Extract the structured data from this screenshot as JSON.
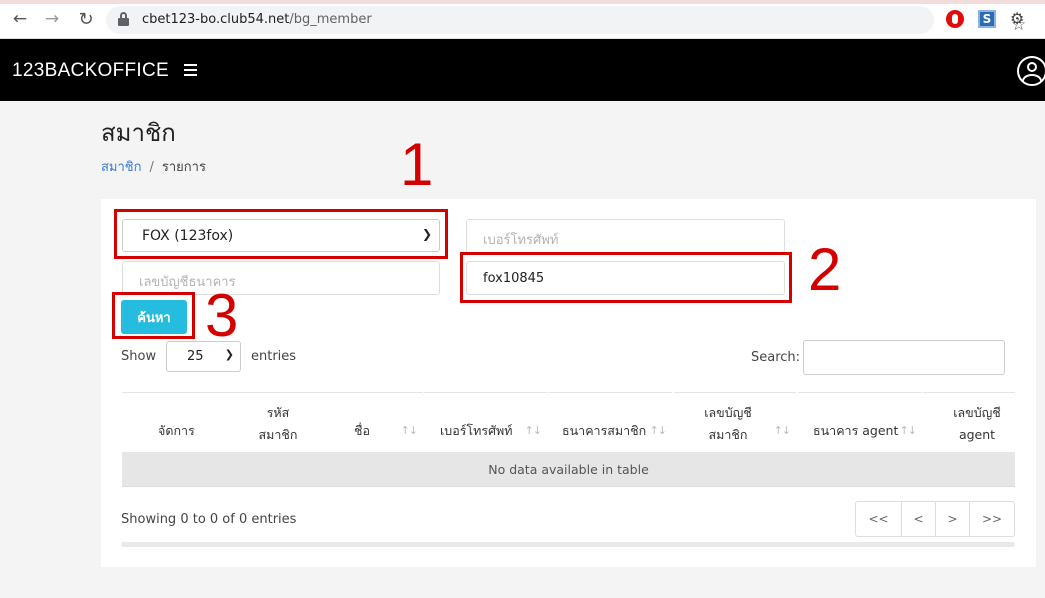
{
  "browser": {
    "url_host": "cbet123-bo.club54.net",
    "url_path": "/bg_member",
    "ext_s_label": "S"
  },
  "app": {
    "brand": "123BACKOFFICE"
  },
  "page": {
    "title": "สมาชิก",
    "breadcrumb": {
      "link": "สมาชิก",
      "separator": "/",
      "current": "รายการ"
    }
  },
  "filters": {
    "agent_select_value": "FOX (123fox)",
    "phone_placeholder": "เบอร์โทรศัพท์",
    "bank_account_placeholder": "เลขบัญชีธนาคาร",
    "username_value": "fox10845",
    "search_button": "ค้นหา"
  },
  "annotations": {
    "n1": "1",
    "n2": "2",
    "n3": "3",
    "color": "#d40000"
  },
  "datatable": {
    "show_label": "Show",
    "length_value": "25",
    "entries_label": "entries",
    "search_label": "Search:",
    "columns": [
      {
        "line1": "",
        "line2": "จัดการ"
      },
      {
        "line1": "รหัส",
        "line2": "สมาชิก"
      },
      {
        "line1": "",
        "line2": "ชื่อ"
      },
      {
        "line1": "",
        "line2": "เบอร์โทรศัพท์"
      },
      {
        "line1": "",
        "line2": "ธนาคารสมาชิก"
      },
      {
        "line1": "เลขบัญชี",
        "line2": "สมาชิก"
      },
      {
        "line1": "",
        "line2": "ธนาคาร agent"
      },
      {
        "line1": "เลขบัญชี",
        "line2": "agent"
      }
    ],
    "empty_message": "No data available in table",
    "info": "Showing 0 to 0 of 0 entries",
    "pager": {
      "first": "<<",
      "prev": "<",
      "next": ">",
      "last": ">>"
    }
  },
  "colors": {
    "header_bg": "#000000",
    "button_bg": "#25bce0",
    "link": "#3a7bd5"
  }
}
